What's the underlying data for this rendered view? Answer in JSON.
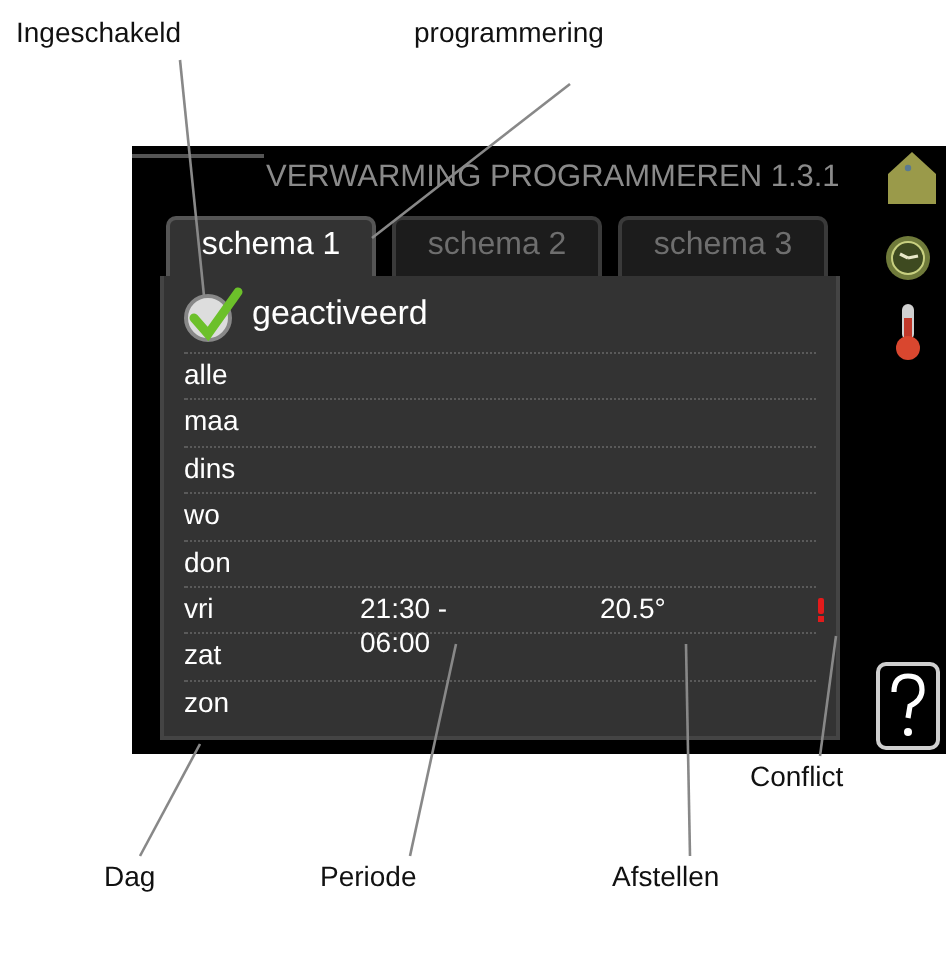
{
  "callouts": [
    {
      "text": "Ingeschakeld"
    },
    {
      "text": "programmering"
    },
    {
      "text": "Dag"
    },
    {
      "text": "Periode"
    },
    {
      "text": "Afstellen"
    },
    {
      "text": "Conflict"
    }
  ],
  "screen": {
    "title": "VERWARMING PROGRAMMEREN 1.3.1",
    "tabs": [
      {
        "label": "schema 1",
        "selected": true
      },
      {
        "label": "schema 2",
        "selected": false
      },
      {
        "label": "schema 3",
        "selected": false
      }
    ],
    "activated": {
      "label": "geactiveerd",
      "checked": true
    },
    "days": [
      {
        "name": "alle",
        "conflict": false
      },
      {
        "name": "maa",
        "conflict": false
      },
      {
        "name": "dins",
        "conflict": false
      },
      {
        "name": "wo",
        "conflict": false
      },
      {
        "name": "don",
        "conflict": false
      },
      {
        "name": "vri",
        "period": "21:30 - 06:00",
        "setting": "20.5°",
        "conflict": true
      },
      {
        "name": "zat",
        "conflict": false
      },
      {
        "name": "zon",
        "conflict": false
      }
    ]
  }
}
